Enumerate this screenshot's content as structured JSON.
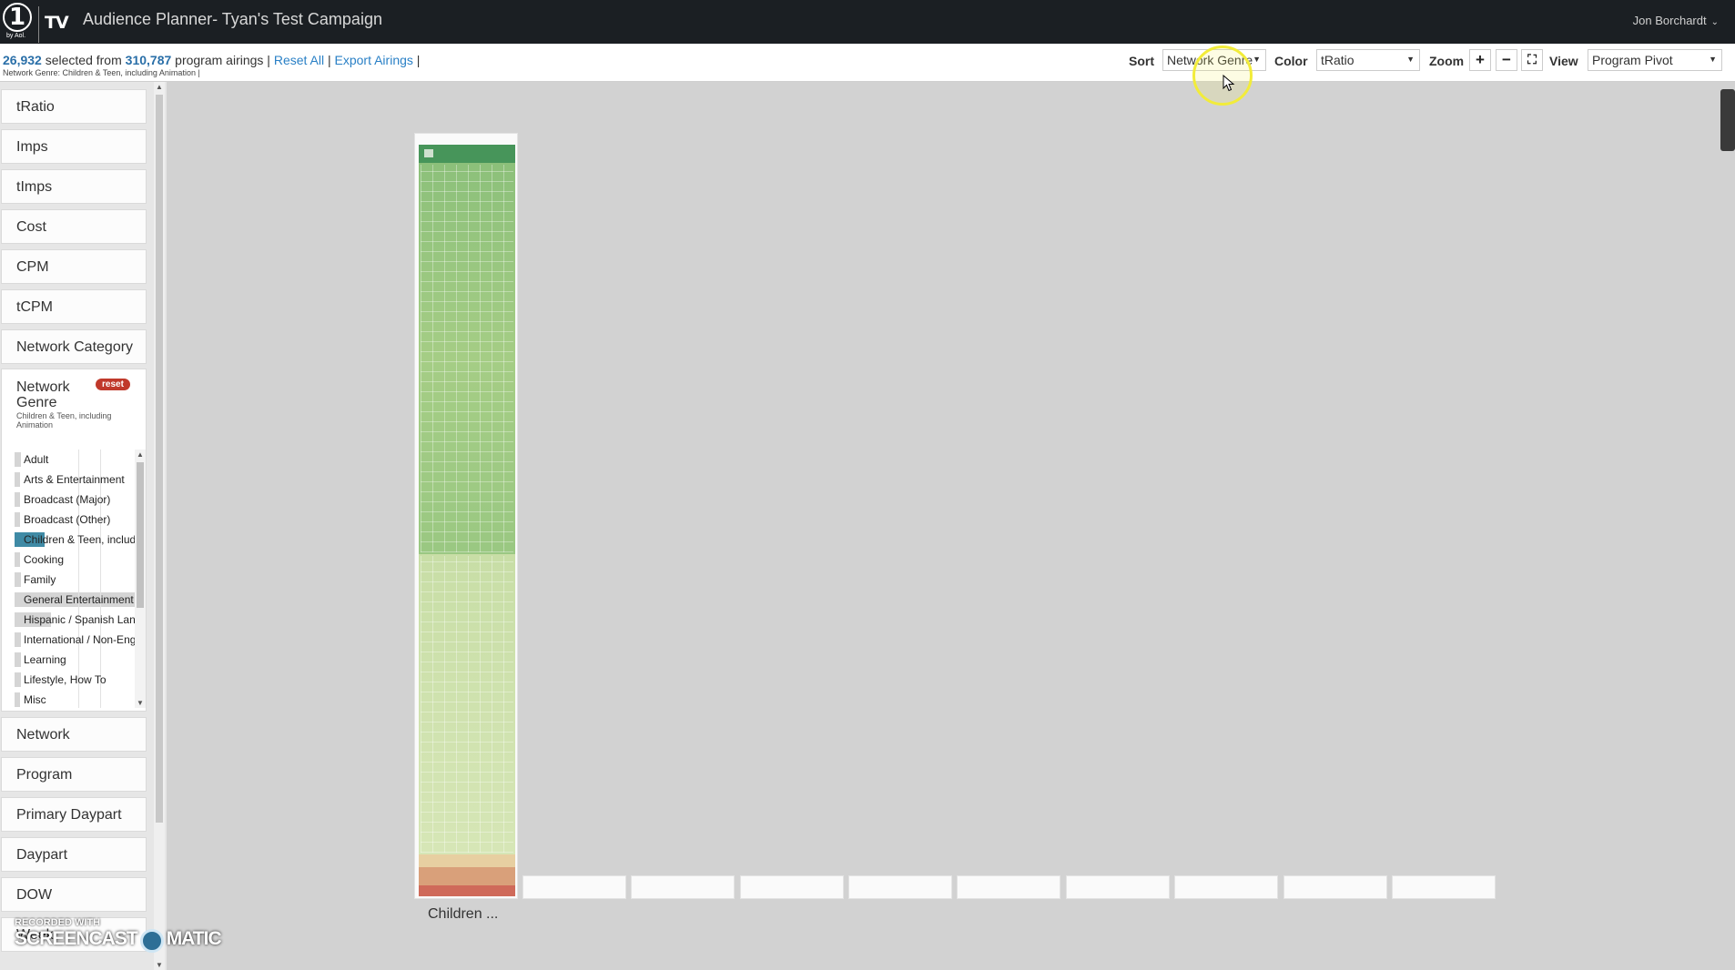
{
  "header": {
    "logo_number": "1",
    "logo_byline": "by Aol.",
    "logo_tv": "TV",
    "title": "Audience Planner- Tyan's Test Campaign",
    "user": "Jon Borchardt"
  },
  "toolbar": {
    "selected_count": "26,932",
    "selected_text": " selected from ",
    "total_count": "310,787",
    "total_text": " program airings | ",
    "reset_all": "Reset All",
    "sep": " | ",
    "export": "Export Airings",
    "sep_end": " |",
    "filter_summary": "Network Genre: Children & Teen, including Animation |",
    "sort_label": "Sort",
    "sort_value": "Network Genre",
    "color_label": "Color",
    "color_value": "tRatio",
    "zoom_label": "Zoom",
    "zoom_in": "+",
    "zoom_out": "−",
    "fullscreen": "⛶",
    "view_label": "View",
    "view_value": "Program Pivot"
  },
  "sidebar": {
    "items_top": [
      {
        "label": "tRatio"
      },
      {
        "label": "Imps"
      },
      {
        "label": "tImps"
      },
      {
        "label": "Cost"
      },
      {
        "label": "CPM"
      },
      {
        "label": "tCPM"
      },
      {
        "label": "Network Category"
      }
    ],
    "genre_panel": {
      "title": "Network Genre",
      "reset": "reset",
      "selected_filter": "Children & Teen, including Animation",
      "options": [
        {
          "label": "Adult",
          "share": 0.05,
          "selected": false
        },
        {
          "label": "Arts & Entertainment",
          "share": 0.04,
          "selected": false
        },
        {
          "label": "Broadcast (Major)",
          "share": 0.03,
          "selected": false
        },
        {
          "label": "Broadcast (Other)",
          "share": 0.03,
          "selected": false
        },
        {
          "label": "Children & Teen, including Animation",
          "share": 0.25,
          "selected": true
        },
        {
          "label": "Cooking",
          "share": 0.03,
          "selected": false
        },
        {
          "label": "Family",
          "share": 0.05,
          "selected": false
        },
        {
          "label": "General Entertainment",
          "share": 1.0,
          "selected": false
        },
        {
          "label": "Hispanic / Spanish Language",
          "share": 0.3,
          "selected": false
        },
        {
          "label": "International / Non-English",
          "share": 0.05,
          "selected": false
        },
        {
          "label": "Learning",
          "share": 0.05,
          "selected": false
        },
        {
          "label": "Lifestyle, How To",
          "share": 0.05,
          "selected": false
        },
        {
          "label": "Misc",
          "share": 0.03,
          "selected": false
        }
      ]
    },
    "items_bottom": [
      {
        "label": "Network"
      },
      {
        "label": "Program"
      },
      {
        "label": "Primary Daypart"
      },
      {
        "label": "Daypart"
      },
      {
        "label": "DOW"
      },
      {
        "label": "Week"
      }
    ]
  },
  "canvas": {
    "column_label": "Children ..."
  },
  "watermark": {
    "line1": "RECORDED WITH",
    "line2a": "SCREENCAST",
    "line2b": "MATIC"
  },
  "colors": {
    "topbar": "#1b1f23",
    "link": "#2a80c6",
    "reset_badge": "#c0392b",
    "selected_bar": "#3f8aa5",
    "tile_dark_green": "#47955a",
    "tile_green": "#9ac882",
    "tile_light_green": "#d6e6b6",
    "tile_tan": "#e7cfa1",
    "tile_orange": "#d9a07a",
    "tile_red": "#cf6a5a"
  }
}
